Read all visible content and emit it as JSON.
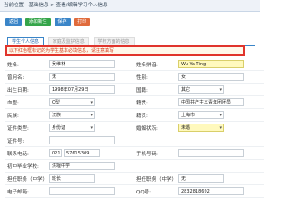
{
  "breadcrumb": "当前位置：基础信息 > 查看/编辑学习个人信息",
  "toolbar": {
    "buttons": [
      {
        "label": "返回",
        "color": "#3a85c8"
      },
      {
        "label": "添加新生",
        "color": "#35a54a"
      },
      {
        "label": "保存",
        "color": "#3a85c8"
      },
      {
        "label": "打印",
        "color": "#e06a3b"
      }
    ]
  },
  "tabs": [
    {
      "label": "学生个人信息",
      "active": true
    },
    {
      "label": "家庭及监护信息",
      "active": false
    },
    {
      "label": "学校方面的信息",
      "active": false
    }
  ],
  "notice": "以下红色框标记的为学生基本必填信息，请注意填写",
  "form": {
    "name": {
      "label": "姓名:",
      "value": "吴维林"
    },
    "pinyin": {
      "label": "姓名拼音:",
      "value": "Wu Ya Ting"
    },
    "alias": {
      "label": "曾用名:",
      "value": "无"
    },
    "gender": {
      "label": "性别:",
      "value": "女"
    },
    "birthdate": {
      "label": "出生日期:",
      "value": "1998年07月29日"
    },
    "nationality": {
      "label": "国籍:",
      "value": "其它"
    },
    "blood": {
      "label": "血型:",
      "value": "O型"
    },
    "country": {
      "label": "籍贯:",
      "value": "中国共产主义青年团团员"
    },
    "ethnic": {
      "label": "民族:",
      "value": "汉族"
    },
    "native": {
      "label": "籍贯:",
      "value": "上海市"
    },
    "idtype": {
      "label": "证件类型:",
      "value": "身份证"
    },
    "marital": {
      "label": "婚姻状况:",
      "value": "未婚"
    },
    "idnum": {
      "label": "证件号:",
      "value": ""
    },
    "phone": {
      "label": "联系电话:",
      "area": "021",
      "number": "57615309"
    },
    "mobile": {
      "label": "手机号码:",
      "value": ""
    },
    "school": {
      "label": "初中毕业学校:",
      "value": "洪堰中学"
    },
    "position": {
      "label": "担任职务（中学）:",
      "value": "班长"
    },
    "position2": {
      "label": "担任职务（中学）:",
      "value": "无"
    },
    "email": {
      "label": "电子邮箱:",
      "value": ""
    },
    "qq": {
      "label": "QQ号:",
      "value": "2832818692"
    }
  }
}
